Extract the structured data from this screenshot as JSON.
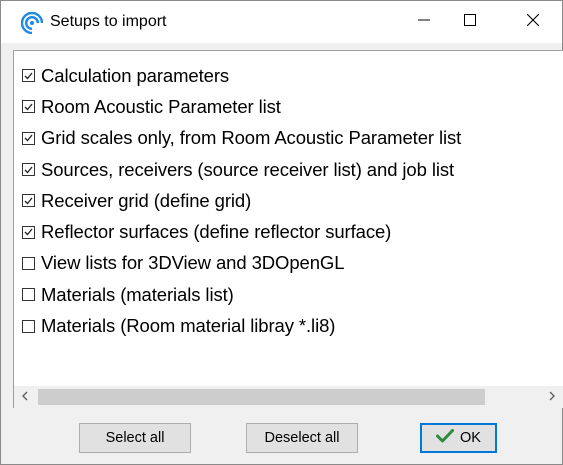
{
  "window": {
    "title": "Setups to import",
    "controls": {
      "minimize": "minimize-icon",
      "maximize": "maximize-icon",
      "close": "close-icon"
    }
  },
  "items": [
    {
      "label": "Calculation parameters",
      "checked": true
    },
    {
      "label": "Room Acoustic Parameter list",
      "checked": true
    },
    {
      "label": "Grid scales only, from Room Acoustic Parameter list",
      "checked": true
    },
    {
      "label": "Sources, receivers (source receiver list) and job list",
      "checked": true
    },
    {
      "label": "Receiver grid (define grid)",
      "checked": true
    },
    {
      "label": "Reflector surfaces (define reflector surface)",
      "checked": true
    },
    {
      "label": "View lists for 3DView and 3DOpenGL",
      "checked": false
    },
    {
      "label": "Materials (materials list)",
      "checked": false
    },
    {
      "label": "Materials (Room material libray *.li8)",
      "checked": false
    }
  ],
  "buttons": {
    "select_all": "Select all",
    "deselect_all": "Deselect all",
    "ok": "OK"
  },
  "colors": {
    "accent": "#0078d7",
    "ok_check": "#2e8b3e",
    "app_icon": "#1e88e5"
  }
}
